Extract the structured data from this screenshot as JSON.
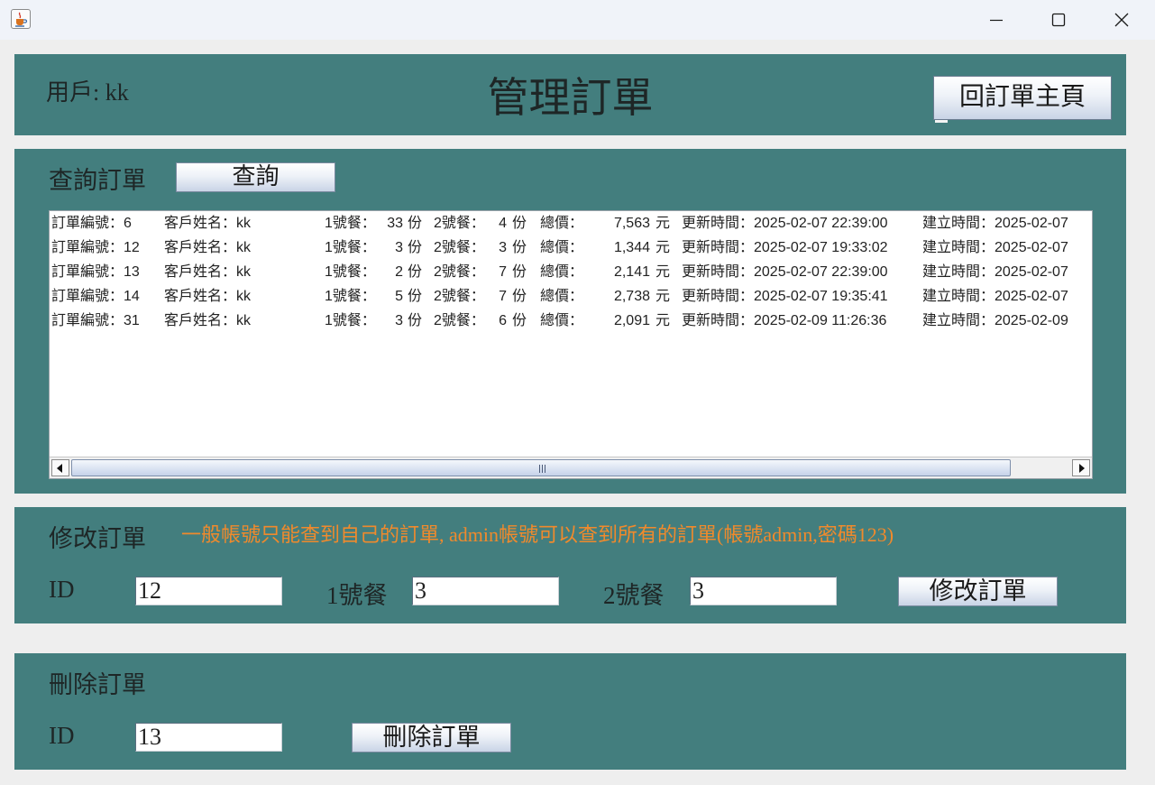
{
  "window": {
    "app_icon": "java-cup-icon",
    "controls": [
      "minimize-icon",
      "maximize-icon",
      "close-icon"
    ]
  },
  "header": {
    "user_label": "用戶: kk",
    "title": "管理訂單",
    "home_button": "回訂單主頁"
  },
  "query": {
    "section_title": "查詢訂單",
    "query_button": "查詢",
    "rows": [
      {
        "id_label": "訂單編號：6",
        "name_label": "客戶姓名：kk",
        "meal1_label": "1號餐：",
        "meal1_qty": "33",
        "unit1": "份",
        "meal2_label": "2號餐：",
        "meal2_qty": "4",
        "unit2": "份",
        "total_label": "總價：",
        "total": "7,563",
        "currency": "元",
        "updated": "更新時間：2025-02-07 22:39:00",
        "created": "建立時間：2025-02-07"
      },
      {
        "id_label": "訂單編號：12",
        "name_label": "客戶姓名：kk",
        "meal1_label": "1號餐：",
        "meal1_qty": "3",
        "unit1": "份",
        "meal2_label": "2號餐：",
        "meal2_qty": "3",
        "unit2": "份",
        "total_label": "總價：",
        "total": "1,344",
        "currency": "元",
        "updated": "更新時間：2025-02-07 19:33:02",
        "created": "建立時間：2025-02-07"
      },
      {
        "id_label": "訂單編號：13",
        "name_label": "客戶姓名：kk",
        "meal1_label": "1號餐：",
        "meal1_qty": "2",
        "unit1": "份",
        "meal2_label": "2號餐：",
        "meal2_qty": "7",
        "unit2": "份",
        "total_label": "總價：",
        "total": "2,141",
        "currency": "元",
        "updated": "更新時間：2025-02-07 22:39:00",
        "created": "建立時間：2025-02-07"
      },
      {
        "id_label": "訂單編號：14",
        "name_label": "客戶姓名：kk",
        "meal1_label": "1號餐：",
        "meal1_qty": "5",
        "unit1": "份",
        "meal2_label": "2號餐：",
        "meal2_qty": "7",
        "unit2": "份",
        "total_label": "總價：",
        "total": "2,738",
        "currency": "元",
        "updated": "更新時間：2025-02-07 19:35:41",
        "created": "建立時間：2025-02-07"
      },
      {
        "id_label": "訂單編號：31",
        "name_label": "客戶姓名：kk",
        "meal1_label": "1號餐：",
        "meal1_qty": "3",
        "unit1": "份",
        "meal2_label": "2號餐：",
        "meal2_qty": "6",
        "unit2": "份",
        "total_label": "總價：",
        "total": "2,091",
        "currency": "元",
        "updated": "更新時間：2025-02-09 11:26:36",
        "created": "建立時間：2025-02-09"
      }
    ]
  },
  "edit": {
    "section_title": "修改訂單",
    "notice": "一般帳號只能查到自己的訂單, admin帳號可以查到所有的訂單(帳號admin,密碼123)",
    "id_label": "ID",
    "id_value": "12",
    "meal1_label": "1號餐",
    "meal1_value": "3",
    "meal2_label": "2號餐",
    "meal2_value": "3",
    "submit_button": "修改訂單"
  },
  "delete": {
    "section_title": "刪除訂單",
    "id_label": "ID",
    "id_value": "13",
    "submit_button": "刪除訂單"
  },
  "colors": {
    "panel_bg": "#437e7e",
    "window_bg": "#eeeeee",
    "notice_text": "#f08a2c",
    "titlebar_bg": "#f0f3f9"
  }
}
